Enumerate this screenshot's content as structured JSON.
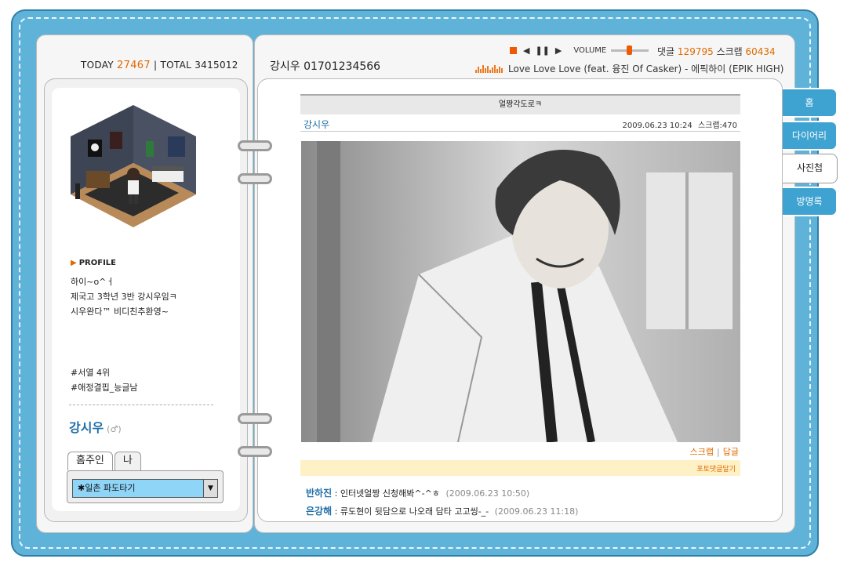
{
  "counter": {
    "today_label": "TODAY",
    "today": "27467",
    "sep": "|",
    "total_label": "TOTAL",
    "total": "3415012"
  },
  "owner_title": "강시우 01701234566",
  "player": {
    "volume_label": "VOLUME",
    "comments_label": "댓글",
    "comments": "129795",
    "scrap_label": "스크랩",
    "scraps": "60434",
    "song": "Love Love Love (feat. 융진 Of Casker) - 에픽하이 (EPIK HIGH)"
  },
  "profile": {
    "header": "PROFILE",
    "lines": [
      "하이~o^ㅓ",
      "제국고 3학년 3반 강시우임ㅋ",
      "시우완다™ 비디친추환영~"
    ],
    "tags": [
      "#서열 4위",
      "#애정결핍_능글남"
    ],
    "name": "강시우",
    "gender": "(♂)",
    "tab_owner": "홈주인",
    "tab_me": "나",
    "select_value": "✱일촌 파도타기"
  },
  "side_tabs": [
    "홈",
    "다이어리",
    "사진첩",
    "방명록"
  ],
  "post": {
    "title": "얼짱각도로ㅋ",
    "author": "강시우",
    "date": "2009.06.23 10:24",
    "scrap": "스크랩:470",
    "action_scrap": "스크랩",
    "action_sep": "|",
    "action_reply": "답글",
    "comment_button": "포토댓글달기"
  },
  "comments": [
    {
      "name": "반하진",
      "text": ": 인터넷얼짱 신청해봐^-^ㅎ",
      "date": "(2009.06.23 10:50)"
    },
    {
      "name": "은강해",
      "text": ": 류도현이 뒷담으로 나오래 담타 고고씽-_-",
      "date": "(2009.06.23 11:18)"
    }
  ],
  "colors": {
    "binder": "#5fb3d9",
    "accent": "#e06a00",
    "link": "#1f6fa8"
  }
}
